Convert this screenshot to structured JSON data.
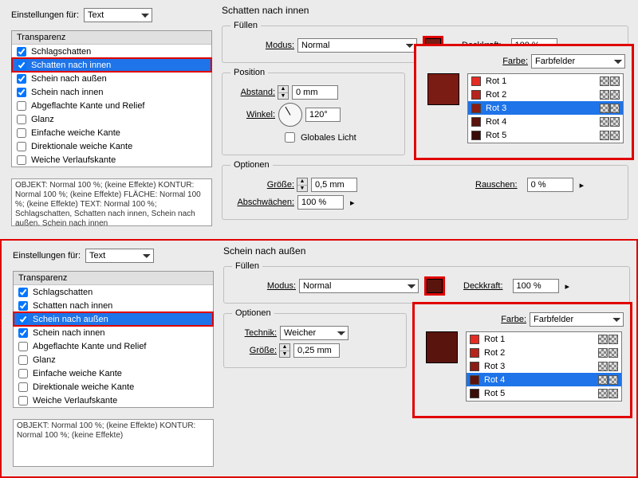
{
  "panels": [
    {
      "settings_for_label": "Einstellungen für:",
      "settings_for_value": "Text",
      "transparenz_header": "Transparenz",
      "section_title": "Schatten nach innen",
      "items": [
        {
          "label": "Schlagschatten",
          "checked": true,
          "selected": false
        },
        {
          "label": "Schatten nach innen",
          "checked": true,
          "selected": true
        },
        {
          "label": "Schein nach außen",
          "checked": true,
          "selected": false
        },
        {
          "label": "Schein nach innen",
          "checked": true,
          "selected": false
        },
        {
          "label": "Abgeflachte Kante und Relief",
          "checked": false,
          "selected": false
        },
        {
          "label": "Glanz",
          "checked": false,
          "selected": false
        },
        {
          "label": "Einfache weiche Kante",
          "checked": false,
          "selected": false
        },
        {
          "label": "Direktionale weiche Kante",
          "checked": false,
          "selected": false
        },
        {
          "label": "Weiche Verlaufskante",
          "checked": false,
          "selected": false
        }
      ],
      "summary": "OBJEKT: Normal 100 %; (keine Effekte)\nKONTUR: Normal 100 %; (keine Effekte)\nFLÄCHE: Normal 100 %; (keine Effekte)\nTEXT: Normal 100 %; Schlagschatten, Schatten nach innen, Schein nach außen, Schein nach innen",
      "fill": {
        "legend": "Füllen",
        "mode_label": "Modus:",
        "mode_value": "Normal",
        "opacity_label": "Deckkraft:",
        "opacity_value": "100 %"
      },
      "position": {
        "legend": "Position",
        "distance_label": "Abstand:",
        "distance_value": "0 mm",
        "angle_label": "Winkel:",
        "angle_value": "120°",
        "global_light": "Globales Licht"
      },
      "options": {
        "legend": "Optionen",
        "size_label": "Größe:",
        "size_value": "0,5 mm",
        "choke_label": "Abschwächen:",
        "choke_value": "100 %",
        "noise_label": "Rauschen:",
        "noise_value": "0 %"
      },
      "color_panel": {
        "farbe_label": "Farbe:",
        "farbe_value": "Farbfelder",
        "swatch": "red3",
        "selected_index": 2,
        "items": [
          "Rot 1",
          "Rot 2",
          "Rot 3",
          "Rot 4",
          "Rot 5"
        ]
      }
    },
    {
      "settings_for_label": "Einstellungen für:",
      "settings_for_value": "Text",
      "transparenz_header": "Transparenz",
      "section_title": "Schein nach außen",
      "items": [
        {
          "label": "Schlagschatten",
          "checked": true,
          "selected": false
        },
        {
          "label": "Schatten nach innen",
          "checked": true,
          "selected": false
        },
        {
          "label": "Schein nach außen",
          "checked": true,
          "selected": true
        },
        {
          "label": "Schein nach innen",
          "checked": true,
          "selected": false
        },
        {
          "label": "Abgeflachte Kante und Relief",
          "checked": false,
          "selected": false
        },
        {
          "label": "Glanz",
          "checked": false,
          "selected": false
        },
        {
          "label": "Einfache weiche Kante",
          "checked": false,
          "selected": false
        },
        {
          "label": "Direktionale weiche Kante",
          "checked": false,
          "selected": false
        },
        {
          "label": "Weiche Verlaufskante",
          "checked": false,
          "selected": false
        }
      ],
      "summary": "OBJEKT: Normal 100 %; (keine Effekte)\nKONTUR: Normal 100 %; (keine Effekte)",
      "fill": {
        "legend": "Füllen",
        "mode_label": "Modus:",
        "mode_value": "Normal",
        "opacity_label": "Deckkraft:",
        "opacity_value": "100 %"
      },
      "options": {
        "legend": "Optionen",
        "tech_label": "Technik:",
        "tech_value": "Weicher",
        "size_label": "Größe:",
        "size_value": "0,25 mm"
      },
      "color_panel": {
        "farbe_label": "Farbe:",
        "farbe_value": "Farbfelder",
        "swatch": "red4",
        "selected_index": 3,
        "items": [
          "Rot 1",
          "Rot 2",
          "Rot 3",
          "Rot 4",
          "Rot 5"
        ]
      }
    }
  ],
  "panel_highlighted_index": 1
}
